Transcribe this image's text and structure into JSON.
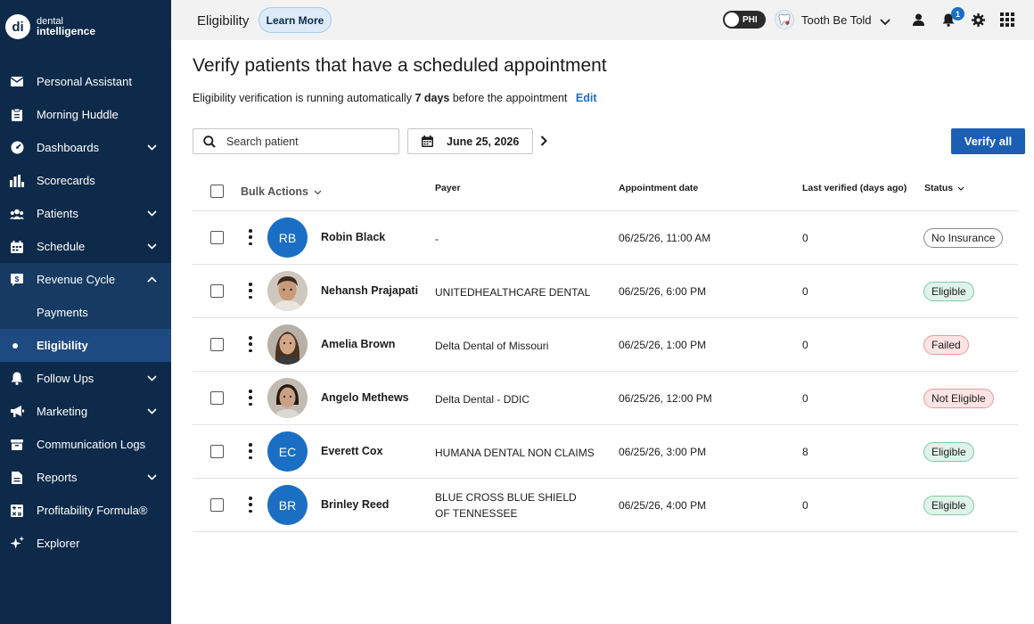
{
  "sidebar": {
    "logo": {
      "mark": "di",
      "line1": "dental",
      "line2": "intelligence"
    },
    "items": [
      {
        "label": "Personal Assistant",
        "icon": "envelope-icon"
      },
      {
        "label": "Morning Huddle",
        "icon": "clipboard-icon"
      },
      {
        "label": "Dashboards",
        "icon": "gauge-icon"
      },
      {
        "label": "Scorecards",
        "icon": "bar-chart-icon"
      },
      {
        "label": "Patients",
        "icon": "people-icon"
      },
      {
        "label": "Schedule",
        "icon": "calendar-icon"
      },
      {
        "label": "Revenue Cycle",
        "icon": "dollar-chat-icon"
      },
      {
        "label": "Payments",
        "icon": ""
      },
      {
        "label": "Eligibility",
        "icon": "dot-icon"
      },
      {
        "label": "Follow Ups",
        "icon": "bell-icon"
      },
      {
        "label": "Marketing",
        "icon": "megaphone-icon"
      },
      {
        "label": "Communication Logs",
        "icon": "inbox-icon"
      },
      {
        "label": "Reports",
        "icon": "document-icon"
      },
      {
        "label": "Profitability Formula®",
        "icon": "calculator-icon"
      },
      {
        "label": "Explorer",
        "icon": "sparkle-icon"
      }
    ]
  },
  "topbar": {
    "title": "Eligibility",
    "learn_more": "Learn More",
    "phi_label": "PHI",
    "practice_name": "Tooth Be Told",
    "notification_count": "1"
  },
  "main": {
    "title": "Verify patients that have a scheduled appointment",
    "subtitle_pre": "Eligibility verification is running automatically",
    "subtitle_bold": "7 days",
    "subtitle_post": "before the appointment",
    "edit_label": "Edit",
    "search_placeholder": "Search patient",
    "date_label": "June 25, 2026",
    "verify_all_label": "Verify all"
  },
  "table": {
    "headers": {
      "bulk_actions": "Bulk Actions",
      "payer": "Payer",
      "appointment_date": "Appointment date",
      "last_verified": "Last verified (days ago)",
      "status": "Status"
    },
    "rows": [
      {
        "initials": "RB",
        "name": "Robin Black",
        "payer": "-",
        "appointment": "06/25/26, 11:00 AM",
        "last_verified": "0",
        "status": "No Insurance"
      },
      {
        "initials": "",
        "name": "Nehansh Prajapati",
        "payer": "UNITEDHEALTHCARE DENTAL",
        "appointment": "06/25/26, 6:00 PM",
        "last_verified": "0",
        "status": "Eligible"
      },
      {
        "initials": "",
        "name": "Amelia Brown",
        "payer": "Delta Dental of Missouri",
        "appointment": "06/25/26, 1:00 PM",
        "last_verified": "0",
        "status": "Failed"
      },
      {
        "initials": "",
        "name": "Angelo Methews",
        "payer": "Delta Dental - DDIC",
        "appointment": "06/25/26, 12:00 PM",
        "last_verified": "0",
        "status": "Not Eligible"
      },
      {
        "initials": "EC",
        "name": "Everett Cox",
        "payer": "HUMANA DENTAL NON CLAIMS",
        "appointment": "06/25/26, 3:00 PM",
        "last_verified": "8",
        "status": "Eligible"
      },
      {
        "initials": "BR",
        "name": "Brinley Reed",
        "payer": "BLUE CROSS BLUE SHIELD OF TENNESSEE",
        "appointment": "06/25/26, 4:00 PM",
        "last_verified": "0",
        "status": "Eligible"
      }
    ]
  },
  "colors": {
    "sidebar_bg": "#0e2a4a",
    "accent": "#1a5fb4",
    "eligible": "#dff3ea",
    "failed": "#fde3e3"
  }
}
